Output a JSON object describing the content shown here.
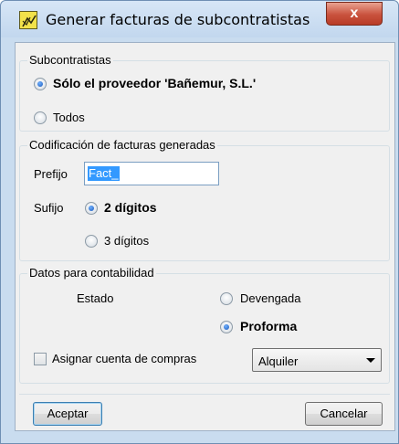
{
  "window": {
    "title": "Generar facturas de subcontratistas",
    "close_label": "x"
  },
  "subcontratistas": {
    "legend": "Subcontratistas",
    "option_solo": "Sólo el proveedor 'Bañemur, S.L.'",
    "option_todos": "Todos",
    "selected": "solo"
  },
  "codificacion": {
    "legend": "Codificación de facturas generadas",
    "prefijo_label": "Prefijo",
    "prefijo_value": "Fact_",
    "sufijo_label": "Sufijo",
    "option_2": "2 dígitos",
    "option_3": "3 dígitos",
    "selected": "2"
  },
  "contabilidad": {
    "legend": "Datos para contabilidad",
    "estado_label": "Estado",
    "option_devengada": "Devengada",
    "option_proforma": "Proforma",
    "selected": "proforma",
    "asignar_label": "Asignar cuenta de compras",
    "asignar_checked": false,
    "cuenta_value": "Alquiler"
  },
  "buttons": {
    "aceptar": "Aceptar",
    "cancelar": "Cancelar"
  }
}
